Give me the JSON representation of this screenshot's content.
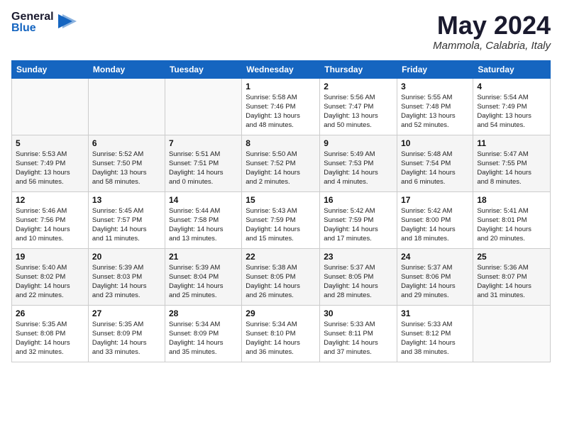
{
  "logo": {
    "line1": "General",
    "line2": "Blue"
  },
  "title": "May 2024",
  "location": "Mammola, Calabria, Italy",
  "days_of_week": [
    "Sunday",
    "Monday",
    "Tuesday",
    "Wednesday",
    "Thursday",
    "Friday",
    "Saturday"
  ],
  "weeks": [
    [
      {
        "day": "",
        "info": ""
      },
      {
        "day": "",
        "info": ""
      },
      {
        "day": "",
        "info": ""
      },
      {
        "day": "1",
        "info": "Sunrise: 5:58 AM\nSunset: 7:46 PM\nDaylight: 13 hours\nand 48 minutes."
      },
      {
        "day": "2",
        "info": "Sunrise: 5:56 AM\nSunset: 7:47 PM\nDaylight: 13 hours\nand 50 minutes."
      },
      {
        "day": "3",
        "info": "Sunrise: 5:55 AM\nSunset: 7:48 PM\nDaylight: 13 hours\nand 52 minutes."
      },
      {
        "day": "4",
        "info": "Sunrise: 5:54 AM\nSunset: 7:49 PM\nDaylight: 13 hours\nand 54 minutes."
      }
    ],
    [
      {
        "day": "5",
        "info": "Sunrise: 5:53 AM\nSunset: 7:49 PM\nDaylight: 13 hours\nand 56 minutes."
      },
      {
        "day": "6",
        "info": "Sunrise: 5:52 AM\nSunset: 7:50 PM\nDaylight: 13 hours\nand 58 minutes."
      },
      {
        "day": "7",
        "info": "Sunrise: 5:51 AM\nSunset: 7:51 PM\nDaylight: 14 hours\nand 0 minutes."
      },
      {
        "day": "8",
        "info": "Sunrise: 5:50 AM\nSunset: 7:52 PM\nDaylight: 14 hours\nand 2 minutes."
      },
      {
        "day": "9",
        "info": "Sunrise: 5:49 AM\nSunset: 7:53 PM\nDaylight: 14 hours\nand 4 minutes."
      },
      {
        "day": "10",
        "info": "Sunrise: 5:48 AM\nSunset: 7:54 PM\nDaylight: 14 hours\nand 6 minutes."
      },
      {
        "day": "11",
        "info": "Sunrise: 5:47 AM\nSunset: 7:55 PM\nDaylight: 14 hours\nand 8 minutes."
      }
    ],
    [
      {
        "day": "12",
        "info": "Sunrise: 5:46 AM\nSunset: 7:56 PM\nDaylight: 14 hours\nand 10 minutes."
      },
      {
        "day": "13",
        "info": "Sunrise: 5:45 AM\nSunset: 7:57 PM\nDaylight: 14 hours\nand 11 minutes."
      },
      {
        "day": "14",
        "info": "Sunrise: 5:44 AM\nSunset: 7:58 PM\nDaylight: 14 hours\nand 13 minutes."
      },
      {
        "day": "15",
        "info": "Sunrise: 5:43 AM\nSunset: 7:59 PM\nDaylight: 14 hours\nand 15 minutes."
      },
      {
        "day": "16",
        "info": "Sunrise: 5:42 AM\nSunset: 7:59 PM\nDaylight: 14 hours\nand 17 minutes."
      },
      {
        "day": "17",
        "info": "Sunrise: 5:42 AM\nSunset: 8:00 PM\nDaylight: 14 hours\nand 18 minutes."
      },
      {
        "day": "18",
        "info": "Sunrise: 5:41 AM\nSunset: 8:01 PM\nDaylight: 14 hours\nand 20 minutes."
      }
    ],
    [
      {
        "day": "19",
        "info": "Sunrise: 5:40 AM\nSunset: 8:02 PM\nDaylight: 14 hours\nand 22 minutes."
      },
      {
        "day": "20",
        "info": "Sunrise: 5:39 AM\nSunset: 8:03 PM\nDaylight: 14 hours\nand 23 minutes."
      },
      {
        "day": "21",
        "info": "Sunrise: 5:39 AM\nSunset: 8:04 PM\nDaylight: 14 hours\nand 25 minutes."
      },
      {
        "day": "22",
        "info": "Sunrise: 5:38 AM\nSunset: 8:05 PM\nDaylight: 14 hours\nand 26 minutes."
      },
      {
        "day": "23",
        "info": "Sunrise: 5:37 AM\nSunset: 8:05 PM\nDaylight: 14 hours\nand 28 minutes."
      },
      {
        "day": "24",
        "info": "Sunrise: 5:37 AM\nSunset: 8:06 PM\nDaylight: 14 hours\nand 29 minutes."
      },
      {
        "day": "25",
        "info": "Sunrise: 5:36 AM\nSunset: 8:07 PM\nDaylight: 14 hours\nand 31 minutes."
      }
    ],
    [
      {
        "day": "26",
        "info": "Sunrise: 5:35 AM\nSunset: 8:08 PM\nDaylight: 14 hours\nand 32 minutes."
      },
      {
        "day": "27",
        "info": "Sunrise: 5:35 AM\nSunset: 8:09 PM\nDaylight: 14 hours\nand 33 minutes."
      },
      {
        "day": "28",
        "info": "Sunrise: 5:34 AM\nSunset: 8:09 PM\nDaylight: 14 hours\nand 35 minutes."
      },
      {
        "day": "29",
        "info": "Sunrise: 5:34 AM\nSunset: 8:10 PM\nDaylight: 14 hours\nand 36 minutes."
      },
      {
        "day": "30",
        "info": "Sunrise: 5:33 AM\nSunset: 8:11 PM\nDaylight: 14 hours\nand 37 minutes."
      },
      {
        "day": "31",
        "info": "Sunrise: 5:33 AM\nSunset: 8:12 PM\nDaylight: 14 hours\nand 38 minutes."
      },
      {
        "day": "",
        "info": ""
      }
    ]
  ]
}
